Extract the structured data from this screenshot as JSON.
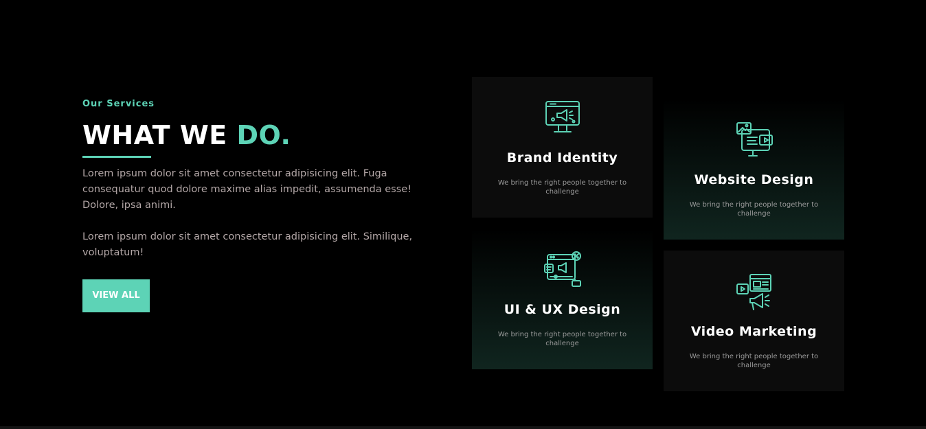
{
  "colors": {
    "accent": "#5dd3b6",
    "background": "#000000",
    "card_dark": "#0c0c0c",
    "card_gradient_end": "#10251f",
    "body_text": "#b3a7a7"
  },
  "intro": {
    "eyebrow": "Our Services",
    "heading_main": "WHAT WE",
    "heading_accent": "DO.",
    "paragraph_1": "Lorem ipsum dolor sit amet consectetur adipisicing elit. Fuga consequatur quod dolore maxime alias impedit, assumenda esse! Dolore, ipsa animi.",
    "paragraph_2": "Lorem ipsum dolor sit amet consectetur adipisicing elit. Similique, voluptatum!",
    "button_label": "VIEW ALL"
  },
  "services": [
    {
      "title": "Brand Identity",
      "description": "We bring the right people together to challenge",
      "icon": "monitor-megaphone-icon"
    },
    {
      "title": "Website Design",
      "description": "We bring the right people together to challenge",
      "icon": "website-media-icon"
    },
    {
      "title": "UI & UX Design",
      "description": "We bring the right people together to challenge",
      "icon": "ui-ux-browser-icon"
    },
    {
      "title": "Video Marketing",
      "description": "We bring the right people together to challenge",
      "icon": "video-megaphone-icon"
    }
  ]
}
